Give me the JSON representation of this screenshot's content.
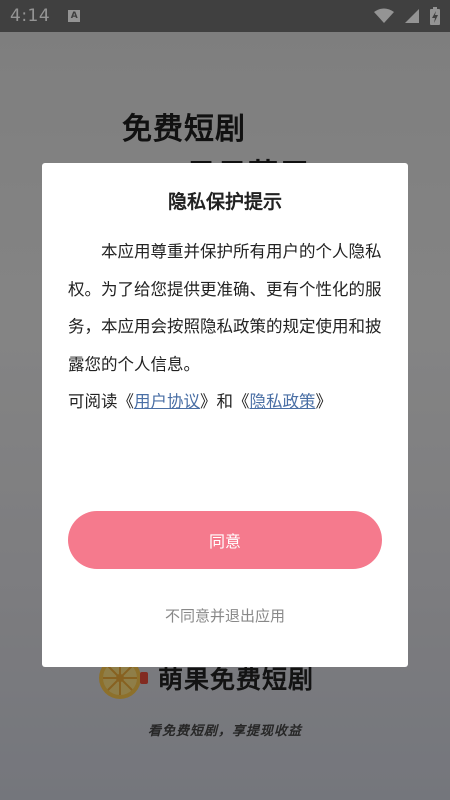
{
  "status_bar": {
    "time": "4:14",
    "notification_badge": "A"
  },
  "splash": {
    "title_line1": "免费短剧",
    "title_line2": "日日薪用",
    "app_name": "萌果免费短剧",
    "slogan": "看免费短剧，享提现收益"
  },
  "dialog": {
    "title": "隐私保护提示",
    "body": "本应用尊重并保护所有用户的个人隐私权。为了给您提供更准确、更有个性化的服务，本应用会按照隐私政策的规定使用和披露您的个人信息。",
    "read_prefix": "可阅读",
    "bracket_open_1": "《",
    "user_agreement": "用户协议",
    "bracket_close_1": "》",
    "and": "和",
    "bracket_open_2": "《",
    "privacy_policy": "隐私政策",
    "bracket_close_2": "》",
    "agree_label": "同意",
    "disagree_label": "不同意并退出应用"
  },
  "colors": {
    "agree_button": "#f57a8d",
    "link": "#4a6fa5",
    "status_bar": "#6e6e6e"
  }
}
